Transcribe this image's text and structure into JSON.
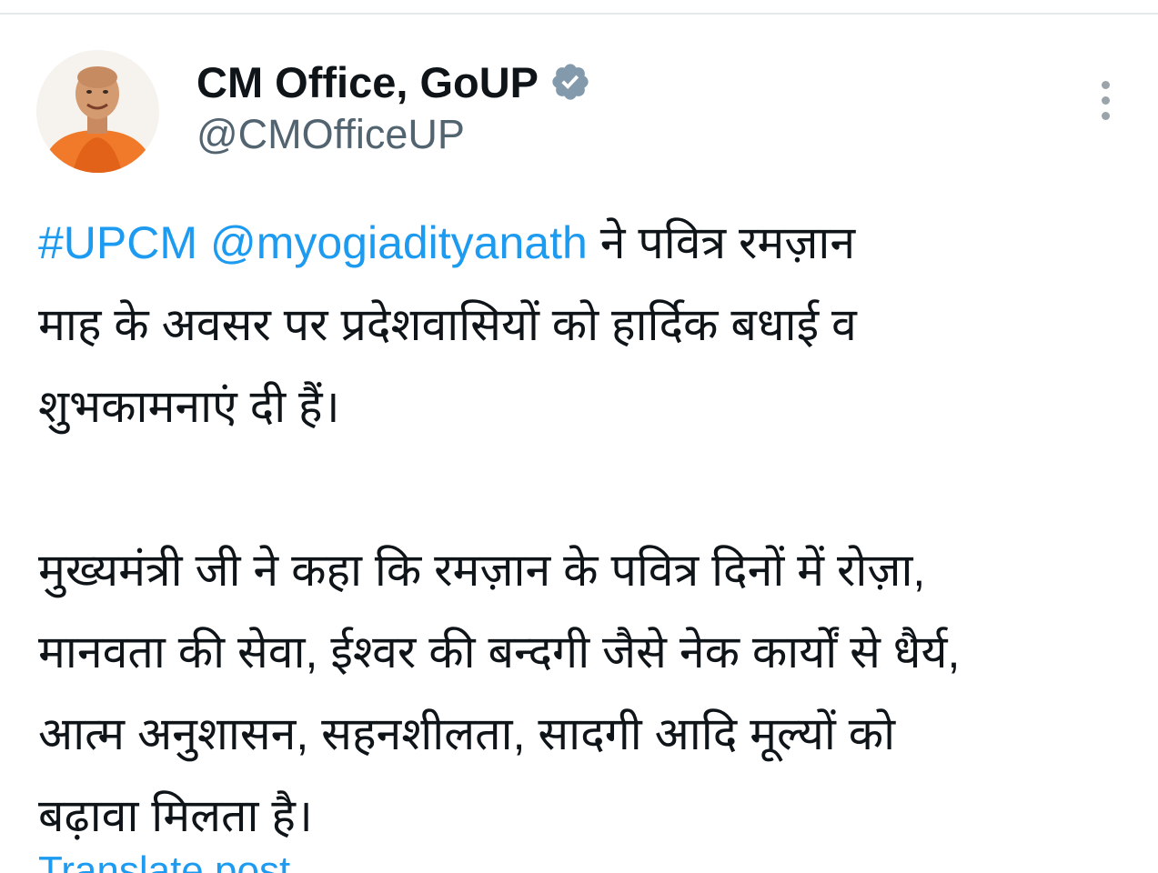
{
  "author": {
    "display_name": "CM Office, GoUP",
    "handle": "@CMOfficeUP",
    "verified_icon": "verified-badge",
    "avatar_icon": "profile-photo"
  },
  "menu": {
    "icon": "more-vertical-icon"
  },
  "tweet": {
    "hashtag": "#UPCM",
    "mention": "@myogiadityanath",
    "line1_rest": " ने पवित्र रमज़ान",
    "line2": "माह के अवसर पर प्रदेशवासियों को हार्दिक बधाई व",
    "line3": "शुभकामनाएं दी हैं।",
    "para2_line1": "मुख्यमंत्री जी ने कहा कि रमज़ान के पवित्र दिनों में रोज़ा,",
    "para2_line2": "मानवता की सेवा, ईश्वर की बन्दगी जैसे नेक कार्यों से धैर्य,",
    "para2_line3": "आत्म अनुशासन, सहनशीलता, सादगी आदि मूल्यों को",
    "para2_line4": "बढ़ावा मिलता है।"
  },
  "translate": {
    "label": "Translate post"
  },
  "colors": {
    "link": "#1d9bf0",
    "text": "#0f1419",
    "secondary": "#536471",
    "verified_badge": "#829aab"
  }
}
